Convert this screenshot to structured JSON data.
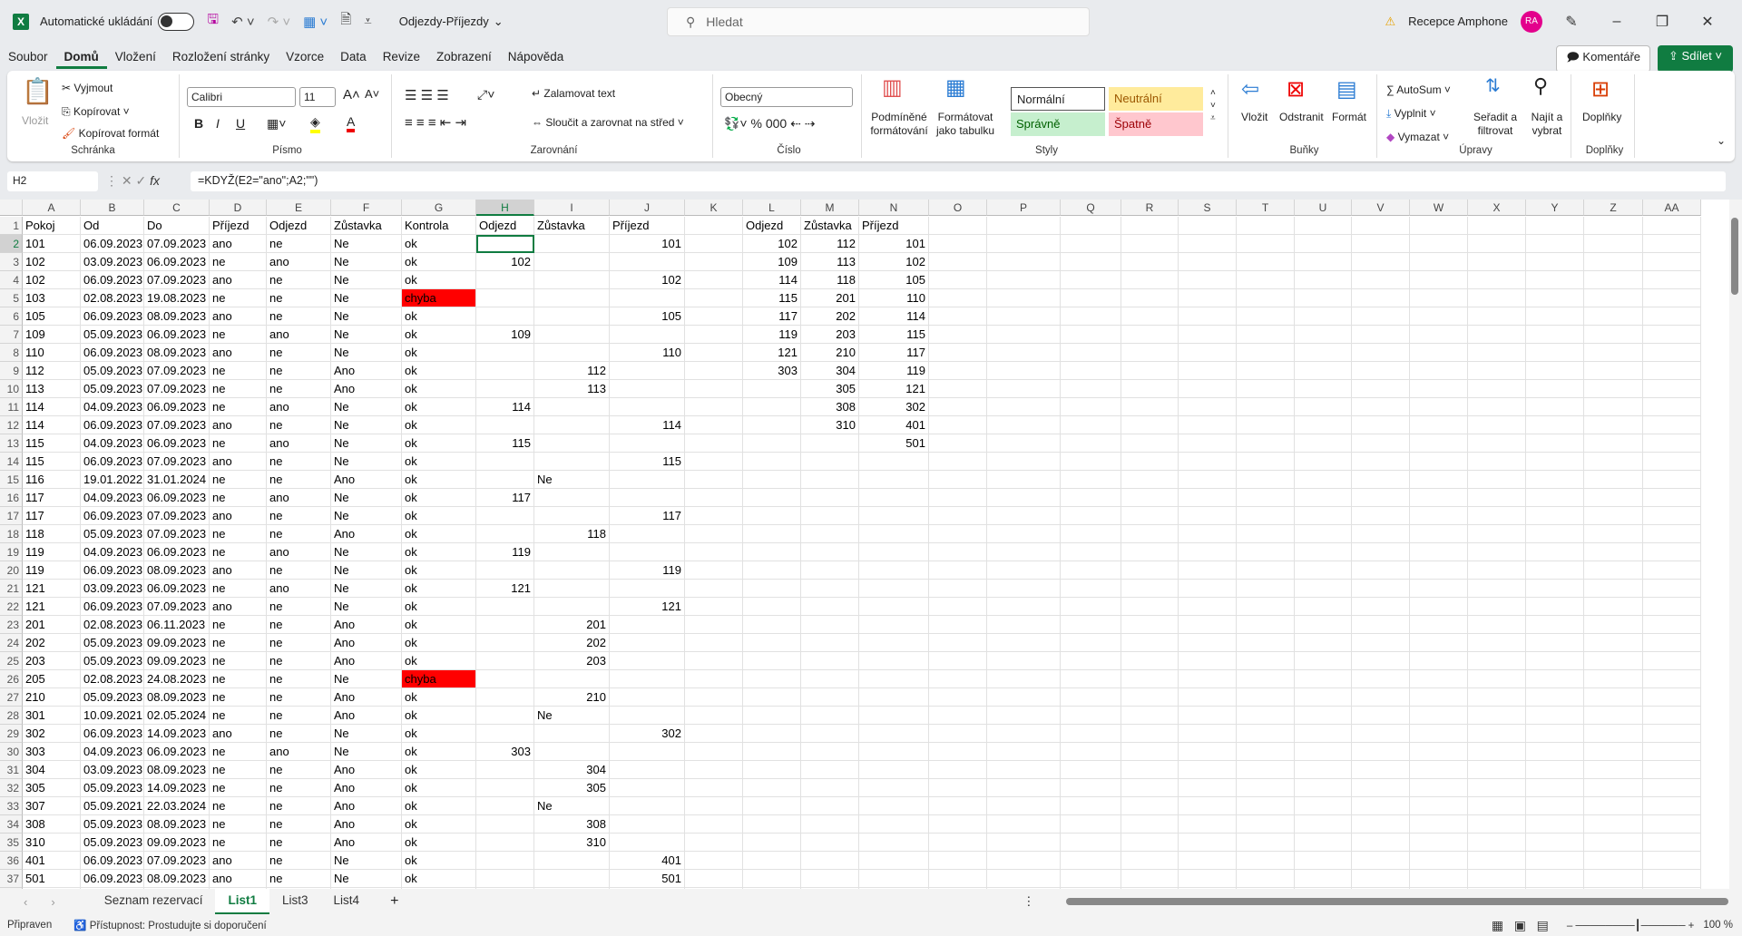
{
  "titlebar": {
    "autosave_label": "Automatické ukládání",
    "filename": "Odjezdy-Příjezdy",
    "search_placeholder": "Hledat",
    "user": "Recepce Amphone",
    "avatar": "RA"
  },
  "menu": {
    "tabs": [
      "Soubor",
      "Domů",
      "Vložení",
      "Rozložení stránky",
      "Vzorce",
      "Data",
      "Revize",
      "Zobrazení",
      "Nápověda"
    ],
    "active": "Domů",
    "comments": "Komentáře",
    "share": "Sdílet"
  },
  "ribbon": {
    "clipboard": {
      "label": "Schránka",
      "paste": "Vložit",
      "cut": "Vyjmout",
      "copy": "Kopírovat",
      "format_painter": "Kopírovat formát"
    },
    "font": {
      "label": "Písmo",
      "name": "Calibri",
      "size": "11",
      "bold": "B",
      "italic": "I",
      "underline": "U"
    },
    "alignment": {
      "label": "Zarovnání",
      "wrap": "Zalamovat text",
      "merge": "Sloučit a zarovnat na střed"
    },
    "number": {
      "label": "Číslo",
      "format": "Obecný"
    },
    "styles": {
      "label": "Styly",
      "conditional": "Podmíněné formátování",
      "as_table": "Formátovat jako tabulku",
      "normal": "Normální",
      "neutral": "Neutrální",
      "good": "Správně",
      "bad": "Špatně"
    },
    "cells": {
      "label": "Buňky",
      "insert": "Vložit",
      "delete": "Odstranit",
      "format": "Formát"
    },
    "editing": {
      "label": "Úpravy",
      "autosum": "AutoSum",
      "fill": "Vyplnit",
      "clear": "Vymazat",
      "sort": "Seřadit a filtrovat",
      "find": "Najít a vybrat"
    },
    "addins": {
      "label": "Doplňky",
      "addins": "Doplňky"
    }
  },
  "formula_bar": {
    "name_box": "H2",
    "formula": "=KDYŽ(E2=\"ano\";A2;\"\")"
  },
  "colors": {
    "accent": "#107c41",
    "error": "#ff0000"
  },
  "sheet": {
    "columns": [
      "A",
      "B",
      "C",
      "D",
      "E",
      "F",
      "G",
      "H",
      "I",
      "J",
      "K",
      "L",
      "M",
      "N",
      "O",
      "P",
      "Q",
      "R",
      "S",
      "T",
      "U",
      "V",
      "W",
      "X",
      "Y",
      "Z",
      "AA"
    ],
    "selected_cell": "H2",
    "rows": [
      [
        "Pokoj",
        "Od",
        "Do",
        "Příjezd",
        "Odjezd",
        "Zůstavka",
        "Kontrola",
        "Odjezd",
        "Zůstavka",
        "Příjezd",
        "",
        "Odjezd",
        "Zůstavka",
        "Příjezd"
      ],
      [
        "101",
        "06.09.2023",
        "07.09.2023",
        "ano",
        "ne",
        "Ne",
        "ok",
        "",
        "",
        "101",
        "",
        "102",
        "112",
        "101"
      ],
      [
        "102",
        "03.09.2023",
        "06.09.2023",
        "ne",
        "ano",
        "Ne",
        "ok",
        "102",
        "",
        "",
        "",
        "109",
        "113",
        "102"
      ],
      [
        "102",
        "06.09.2023",
        "07.09.2023",
        "ano",
        "ne",
        "Ne",
        "ok",
        "",
        "",
        "102",
        "",
        "114",
        "118",
        "105"
      ],
      [
        "103",
        "02.08.2023",
        "19.08.2023",
        "ne",
        "ne",
        "Ne",
        "chyba",
        "",
        "",
        "",
        "",
        "115",
        "201",
        "110"
      ],
      [
        "105",
        "06.09.2023",
        "08.09.2023",
        "ano",
        "ne",
        "Ne",
        "ok",
        "",
        "",
        "105",
        "",
        "117",
        "202",
        "114"
      ],
      [
        "109",
        "05.09.2023",
        "06.09.2023",
        "ne",
        "ano",
        "Ne",
        "ok",
        "109",
        "",
        "",
        "",
        "119",
        "203",
        "115"
      ],
      [
        "110",
        "06.09.2023",
        "08.09.2023",
        "ano",
        "ne",
        "Ne",
        "ok",
        "",
        "",
        "110",
        "",
        "121",
        "210",
        "117"
      ],
      [
        "112",
        "05.09.2023",
        "07.09.2023",
        "ne",
        "ne",
        "Ano",
        "ok",
        "",
        "112",
        "",
        "",
        "303",
        "304",
        "119"
      ],
      [
        "113",
        "05.09.2023",
        "07.09.2023",
        "ne",
        "ne",
        "Ano",
        "ok",
        "",
        "113",
        "",
        "",
        "",
        "305",
        "121"
      ],
      [
        "114",
        "04.09.2023",
        "06.09.2023",
        "ne",
        "ano",
        "Ne",
        "ok",
        "114",
        "",
        "",
        "",
        "",
        "308",
        "302"
      ],
      [
        "114",
        "06.09.2023",
        "07.09.2023",
        "ano",
        "ne",
        "Ne",
        "ok",
        "",
        "",
        "114",
        "",
        "",
        "310",
        "401"
      ],
      [
        "115",
        "04.09.2023",
        "06.09.2023",
        "ne",
        "ano",
        "Ne",
        "ok",
        "115",
        "",
        "",
        "",
        "",
        "",
        "501"
      ],
      [
        "115",
        "06.09.2023",
        "07.09.2023",
        "ano",
        "ne",
        "Ne",
        "ok",
        "",
        "",
        "115",
        "",
        "",
        "",
        ""
      ],
      [
        "116",
        "19.01.2022",
        "31.01.2024",
        "ne",
        "ne",
        "Ano",
        "ok",
        "",
        "Ne",
        "",
        "",
        "",
        "",
        ""
      ],
      [
        "117",
        "04.09.2023",
        "06.09.2023",
        "ne",
        "ano",
        "Ne",
        "ok",
        "117",
        "",
        "",
        "",
        "",
        "",
        ""
      ],
      [
        "117",
        "06.09.2023",
        "07.09.2023",
        "ano",
        "ne",
        "Ne",
        "ok",
        "",
        "",
        "117",
        "",
        "",
        "",
        ""
      ],
      [
        "118",
        "05.09.2023",
        "07.09.2023",
        "ne",
        "ne",
        "Ano",
        "ok",
        "",
        "118",
        "",
        "",
        "",
        "",
        ""
      ],
      [
        "119",
        "04.09.2023",
        "06.09.2023",
        "ne",
        "ano",
        "Ne",
        "ok",
        "119",
        "",
        "",
        "",
        "",
        "",
        ""
      ],
      [
        "119",
        "06.09.2023",
        "08.09.2023",
        "ano",
        "ne",
        "Ne",
        "ok",
        "",
        "",
        "119",
        "",
        "",
        "",
        ""
      ],
      [
        "121",
        "03.09.2023",
        "06.09.2023",
        "ne",
        "ano",
        "Ne",
        "ok",
        "121",
        "",
        "",
        "",
        "",
        "",
        ""
      ],
      [
        "121",
        "06.09.2023",
        "07.09.2023",
        "ano",
        "ne",
        "Ne",
        "ok",
        "",
        "",
        "121",
        "",
        "",
        "",
        ""
      ],
      [
        "201",
        "02.08.2023",
        "06.11.2023",
        "ne",
        "ne",
        "Ano",
        "ok",
        "",
        "201",
        "",
        "",
        "",
        "",
        ""
      ],
      [
        "202",
        "05.09.2023",
        "09.09.2023",
        "ne",
        "ne",
        "Ano",
        "ok",
        "",
        "202",
        "",
        "",
        "",
        "",
        ""
      ],
      [
        "203",
        "05.09.2023",
        "09.09.2023",
        "ne",
        "ne",
        "Ano",
        "ok",
        "",
        "203",
        "",
        "",
        "",
        "",
        ""
      ],
      [
        "205",
        "02.08.2023",
        "24.08.2023",
        "ne",
        "ne",
        "Ne",
        "chyba",
        "",
        "",
        "",
        "",
        "",
        "",
        ""
      ],
      [
        "210",
        "05.09.2023",
        "08.09.2023",
        "ne",
        "ne",
        "Ano",
        "ok",
        "",
        "210",
        "",
        "",
        "",
        "",
        ""
      ],
      [
        "301",
        "10.09.2021",
        "02.05.2024",
        "ne",
        "ne",
        "Ano",
        "ok",
        "",
        "Ne",
        "",
        "",
        "",
        "",
        ""
      ],
      [
        "302",
        "06.09.2023",
        "14.09.2023",
        "ano",
        "ne",
        "Ne",
        "ok",
        "",
        "",
        "302",
        "",
        "",
        "",
        ""
      ],
      [
        "303",
        "04.09.2023",
        "06.09.2023",
        "ne",
        "ano",
        "Ne",
        "ok",
        "303",
        "",
        "",
        "",
        "",
        "",
        ""
      ],
      [
        "304",
        "03.09.2023",
        "08.09.2023",
        "ne",
        "ne",
        "Ano",
        "ok",
        "",
        "304",
        "",
        "",
        "",
        "",
        ""
      ],
      [
        "305",
        "05.09.2023",
        "14.09.2023",
        "ne",
        "ne",
        "Ano",
        "ok",
        "",
        "305",
        "",
        "",
        "",
        "",
        ""
      ],
      [
        "307",
        "05.09.2021",
        "22.03.2024",
        "ne",
        "ne",
        "Ano",
        "ok",
        "",
        "Ne",
        "",
        "",
        "",
        "",
        ""
      ],
      [
        "308",
        "05.09.2023",
        "08.09.2023",
        "ne",
        "ne",
        "Ano",
        "ok",
        "",
        "308",
        "",
        "",
        "",
        "",
        ""
      ],
      [
        "310",
        "05.09.2023",
        "09.09.2023",
        "ne",
        "ne",
        "Ano",
        "ok",
        "",
        "310",
        "",
        "",
        "",
        "",
        ""
      ],
      [
        "401",
        "06.09.2023",
        "07.09.2023",
        "ano",
        "ne",
        "Ne",
        "ok",
        "",
        "",
        "401",
        "",
        "",
        "",
        ""
      ],
      [
        "501",
        "06.09.2023",
        "08.09.2023",
        "ano",
        "ne",
        "Ne",
        "ok",
        "",
        "",
        "501",
        "",
        "",
        "",
        ""
      ]
    ]
  },
  "sheet_tabs": {
    "tabs": [
      "Seznam rezervací",
      "List1",
      "List3",
      "List4"
    ],
    "active": "List1",
    "add": "+"
  },
  "status": {
    "ready": "Připraven",
    "accessibility": "Přístupnost: Prostudujte si doporučení",
    "zoom": "100 %"
  }
}
